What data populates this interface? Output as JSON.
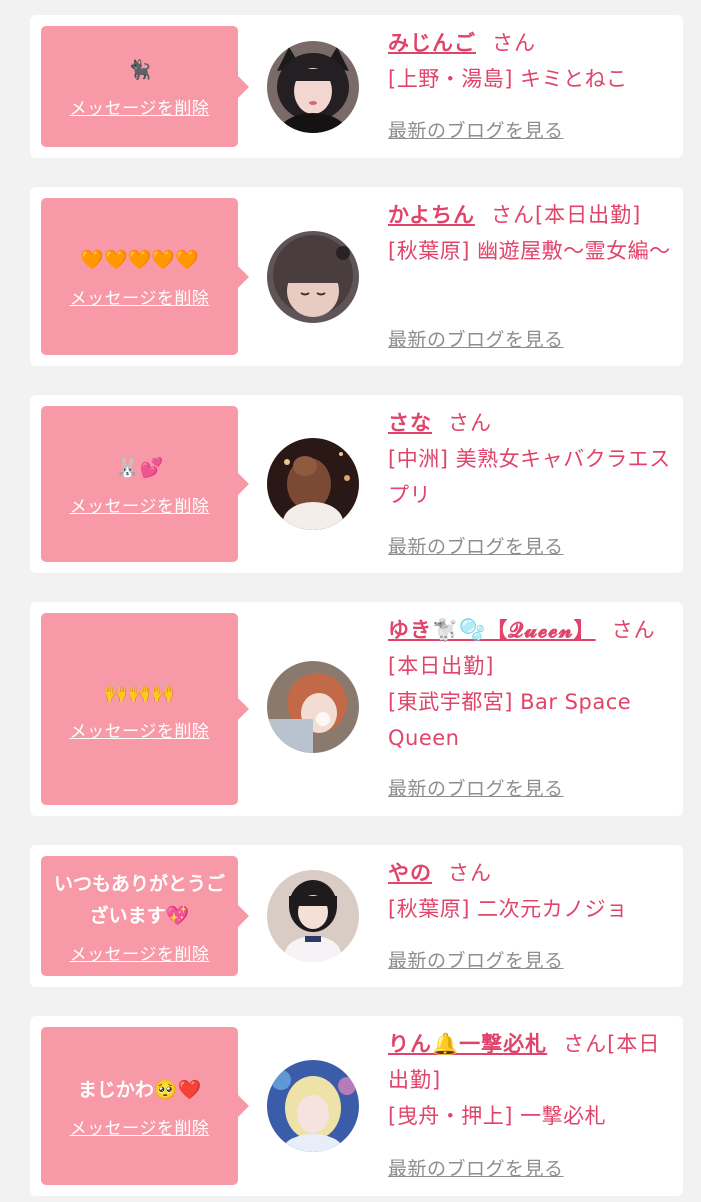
{
  "colors": {
    "page_bg": "#f2f2f2",
    "card_bg": "#ffffff",
    "bubble": "#f899a7",
    "name": "#e0446a",
    "blog_link": "#8e8e8e"
  },
  "delete_label": "メッセージを削除",
  "san_label": "さん",
  "blog_label": "最新のブログを見る",
  "cards": [
    {
      "message": "🐈‍⬛",
      "name": "みじんご",
      "status": "",
      "area": "[上野・湯島]",
      "shop": "キミとねこ",
      "avatar_icon": "avatar-photo"
    },
    {
      "message": "🧡🧡🧡🧡🧡",
      "name": "かよちん",
      "status": "[本日出勤]",
      "area": "[秋葉原]",
      "shop": "幽遊屋敷〜霊女編〜",
      "avatar_icon": "avatar-photo"
    },
    {
      "message": "🐰💕",
      "name": "さな",
      "status": "",
      "area": "[中洲]",
      "shop": "美熟女キャバクラエスプリ",
      "avatar_icon": "avatar-photo"
    },
    {
      "message": "🙌🙌🙌",
      "name": "ゆき🐩🫧【𝓠𝓾𝓮𝓮𝓷】",
      "status": "[本日出勤]",
      "area": "[東武宇都宮]",
      "shop": "Bar Space Queen",
      "avatar_icon": "avatar-photo"
    },
    {
      "message": "いつもありがとうございます💖",
      "name": "やの",
      "status": "",
      "area": "[秋葉原]",
      "shop": "二次元カノジョ",
      "avatar_icon": "avatar-photo"
    },
    {
      "message": "まじかわ🥺❤️",
      "name": "りん🔔一撃必札",
      "status": "[本日出勤]",
      "area": "[曳舟・押上]",
      "shop": "一撃必札",
      "avatar_icon": "avatar-photo"
    }
  ]
}
